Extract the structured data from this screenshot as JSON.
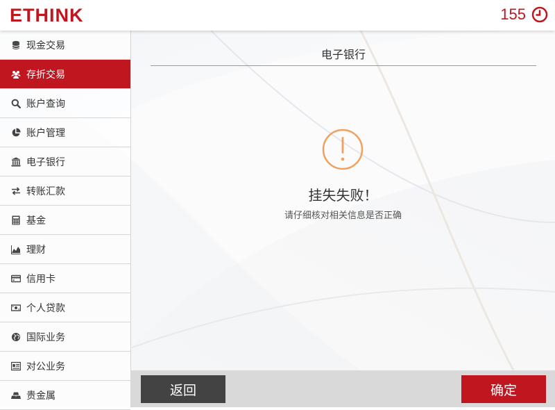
{
  "header": {
    "logo": "ETHINK",
    "timer": "155",
    "timer_icon": "clock-icon"
  },
  "sidebar": {
    "items": [
      {
        "label": "现金交易",
        "icon": "database-icon",
        "active": false
      },
      {
        "label": "存折交易",
        "icon": "users-icon",
        "active": true
      },
      {
        "label": "账户查询",
        "icon": "search-icon",
        "active": false
      },
      {
        "label": "账户管理",
        "icon": "pie-chart-icon",
        "active": false
      },
      {
        "label": "电子银行",
        "icon": "bank-icon",
        "active": false
      },
      {
        "label": "转账汇款",
        "icon": "exchange-icon",
        "active": false
      },
      {
        "label": "基金",
        "icon": "calculator-icon",
        "active": false
      },
      {
        "label": "理财",
        "icon": "area-chart-icon",
        "active": false
      },
      {
        "label": "信用卡",
        "icon": "credit-card-icon",
        "active": false
      },
      {
        "label": "个人贷款",
        "icon": "money-icon",
        "active": false
      },
      {
        "label": "国际业务",
        "icon": "globe-icon",
        "active": false
      },
      {
        "label": "对公业务",
        "icon": "id-card-icon",
        "active": false
      },
      {
        "label": "贵金属",
        "icon": "gold-bars-icon",
        "active": false
      }
    ]
  },
  "main": {
    "title": "电子银行",
    "result_icon": "alert-circle-icon",
    "result_title": "挂失失败！",
    "result_message": "请仔细核对相关信息是否正确"
  },
  "footer": {
    "back_label": "返回",
    "confirm_label": "确定"
  },
  "colors": {
    "brand": "#c0161f",
    "alert": "#f0a15e",
    "back_button": "#434343",
    "footer_bg": "#d9d9d9"
  }
}
